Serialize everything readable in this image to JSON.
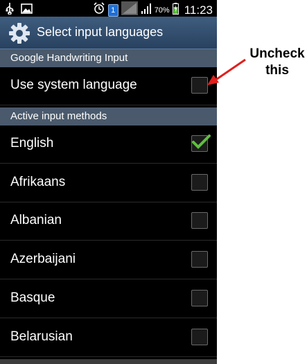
{
  "status_bar": {
    "battery_percent": "70%",
    "time": "11:23",
    "notification_count": "1",
    "icons": [
      "usb-icon",
      "image-icon",
      "alarm-icon",
      "notification-badge",
      "signal-icon",
      "wifi-signal-icon",
      "battery-icon"
    ]
  },
  "header": {
    "title": "Select input languages",
    "icon": "gear-icon"
  },
  "sections": {
    "handwriting": "Google Handwriting Input",
    "active_methods": "Active input methods"
  },
  "system_language": {
    "label": "Use system language",
    "checked": false
  },
  "languages": [
    {
      "label": "English",
      "checked": true
    },
    {
      "label": "Afrikaans",
      "checked": false
    },
    {
      "label": "Albanian",
      "checked": false
    },
    {
      "label": "Azerbaijani",
      "checked": false
    },
    {
      "label": "Basque",
      "checked": false
    },
    {
      "label": "Belarusian",
      "checked": false
    }
  ],
  "annotation": {
    "line1": "Uncheck",
    "line2": "this",
    "color": "#e0201c"
  },
  "colors": {
    "check": "#5fbf3f",
    "section_bg": "#4a5a6c",
    "actionbar": "#33506f"
  }
}
